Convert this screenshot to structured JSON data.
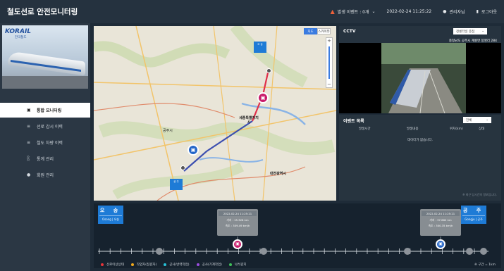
{
  "header": {
    "title": "철도선로 안전모니터링",
    "event_label": "발생 이벤트 : 0개",
    "datetime": "2022-02-24 11:25:22",
    "user_label": "관리자님",
    "logout_label": "로그아웃"
  },
  "sidebar": {
    "logo_text": "KORAIL",
    "logo_sub": "한국철도",
    "items": [
      {
        "label": "통합 모니터링",
        "icon": "monitor-icon",
        "active": true
      },
      {
        "label": "선로 감시 이력",
        "icon": "list-icon",
        "active": false
      },
      {
        "label": "철도 차량 이력",
        "icon": "list-icon",
        "active": false
      },
      {
        "label": "통계 관리",
        "icon": "bar-chart-icon",
        "active": false
      },
      {
        "label": "회원 관리",
        "icon": "user-icon",
        "active": false
      }
    ]
  },
  "map": {
    "btn_map": "지도",
    "btn_sat": "스카이뷰",
    "city_labels": [
      "세종특별자치시",
      "공주시",
      "대전광역시"
    ],
    "station_oseong": "오 송",
    "station_gongju": "공 주"
  },
  "cctv": {
    "title": "CCTV",
    "select_value": "청룡터널 종점",
    "location": "충청남도 공주시 계룡면 봉명리 284"
  },
  "events": {
    "title": "이벤트 목록",
    "filter_value": "전체",
    "columns": [
      "발생시간",
      "발생내용",
      "위치(km)",
      "상태"
    ],
    "empty_message": "데이터가 없습니다.",
    "note": "※ 최근 당시간의 정보입니다."
  },
  "route": {
    "origin": {
      "name": "오 송",
      "sub": "Osong | 오송"
    },
    "destination": {
      "name": "공 주",
      "sub": "Gongju | 공주"
    },
    "train_left": {
      "time": "2022-02-24 11:25:21",
      "distance": "거리 : 15.326 km",
      "speed": "속도 : 309.49 km/h"
    },
    "train_right": {
      "time": "2022-02-24 11:25:21",
      "distance": "거리 : 37.662 km",
      "speed": "속도 : 300.35 km/h"
    },
    "legend": [
      {
        "label": "선로이상상태",
        "color": "#e8343a"
      },
      {
        "label": "작업자(점검자)",
        "color": "#f0a81c"
      },
      {
        "label": "공사(반력작업)",
        "color": "#27c2d8"
      },
      {
        "label": "공사(기계작업)",
        "color": "#9b4de0"
      },
      {
        "label": "낙석감지",
        "color": "#3fc05a"
      }
    ],
    "scale_note": "※ 구간 = 1km"
  }
}
